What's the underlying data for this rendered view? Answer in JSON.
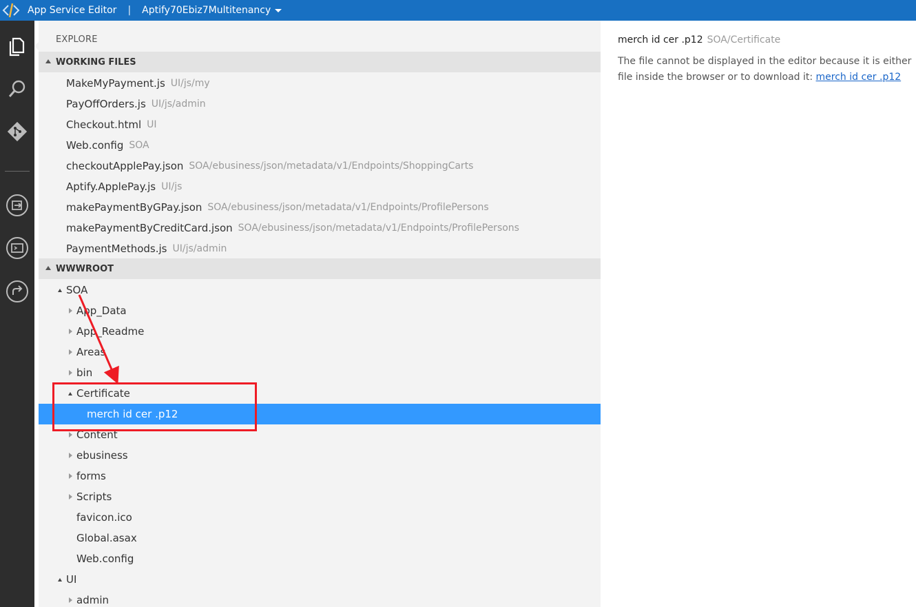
{
  "titlebar": {
    "app_title": "App Service Editor",
    "separator": "|",
    "site_name": "Aptify70Ebiz7Multitenancy"
  },
  "activity_bar": {
    "items": [
      "files-icon",
      "search-icon",
      "git-icon",
      "output-icon",
      "console-icon",
      "redeploy-icon"
    ]
  },
  "sidebar": {
    "explore_title": "EXPLORE",
    "working_files_header": "WORKING FILES",
    "working_files": [
      {
        "name": "MakeMyPayment.js",
        "path": "UI/js/my"
      },
      {
        "name": "PayOffOrders.js",
        "path": "UI/js/admin"
      },
      {
        "name": "Checkout.html",
        "path": "UI"
      },
      {
        "name": "Web.config",
        "path": "SOA"
      },
      {
        "name": "checkoutApplePay.json",
        "path": "SOA/ebusiness/json/metadata/v1/Endpoints/ShoppingCarts"
      },
      {
        "name": "Aptify.ApplePay.js",
        "path": "UI/js"
      },
      {
        "name": "makePaymentByGPay.json",
        "path": "SOA/ebusiness/json/metadata/v1/Endpoints/ProfilePersons"
      },
      {
        "name": "makePaymentByCreditCard.json",
        "path": "SOA/ebusiness/json/metadata/v1/Endpoints/ProfilePersons"
      },
      {
        "name": "PaymentMethods.js",
        "path": "UI/js/admin"
      }
    ],
    "wwwroot_header": "WWWROOT",
    "tree": [
      {
        "name": "SOA",
        "level": 0,
        "state": "open"
      },
      {
        "name": "App_Data",
        "level": 1,
        "state": "closed"
      },
      {
        "name": "App_Readme",
        "level": 1,
        "state": "closed"
      },
      {
        "name": "Areas",
        "level": 1,
        "state": "closed"
      },
      {
        "name": "bin",
        "level": 1,
        "state": "closed"
      },
      {
        "name": "Certificate",
        "level": 1,
        "state": "open"
      },
      {
        "name": "merch id cer .p12",
        "level": 2,
        "state": "file",
        "selected": true
      },
      {
        "name": "Content",
        "level": 1,
        "state": "closed"
      },
      {
        "name": "ebusiness",
        "level": 1,
        "state": "closed"
      },
      {
        "name": "forms",
        "level": 1,
        "state": "closed"
      },
      {
        "name": "Scripts",
        "level": 1,
        "state": "closed"
      },
      {
        "name": "favicon.ico",
        "level": 1,
        "state": "file"
      },
      {
        "name": "Global.asax",
        "level": 1,
        "state": "file"
      },
      {
        "name": "Web.config",
        "level": 1,
        "state": "file"
      },
      {
        "name": "UI",
        "level": 0,
        "state": "open"
      },
      {
        "name": "admin",
        "level": 1,
        "state": "closed"
      }
    ]
  },
  "editor": {
    "file_name": "merch id cer .p12",
    "file_path": "SOA/Certificate",
    "message_line1": "The file cannot be displayed in the editor because it is either",
    "message_line2": "file inside the browser or to download it: ",
    "download_link": "merch id cer .p12"
  },
  "colors": {
    "titlebar": "#1870c2",
    "activitybar": "#2d2d2d",
    "sidebar": "#f3f3f3",
    "selection": "#3399ff",
    "annotation": "#ee1c25"
  }
}
